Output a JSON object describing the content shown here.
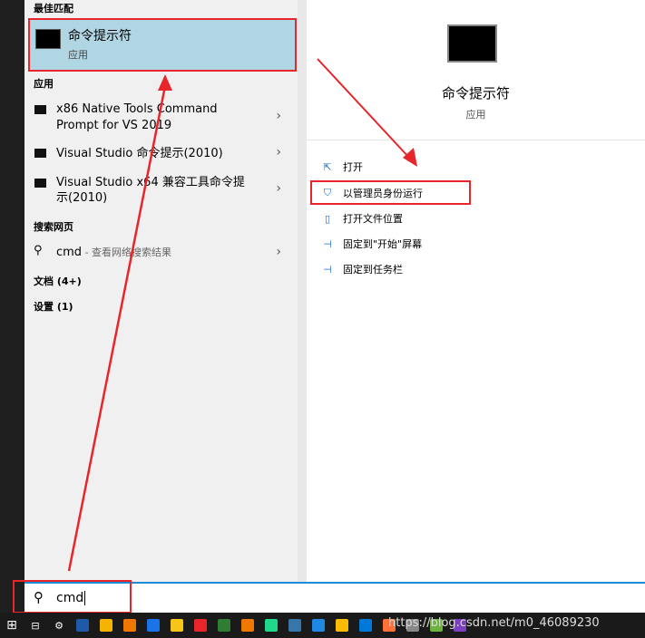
{
  "left": {
    "best_match_header": "最佳匹配",
    "best_match": {
      "title": "命令提示符",
      "subtitle": "应用"
    },
    "apps_header": "应用",
    "apps": [
      {
        "line1": "x86 Native Tools Command",
        "line2": "Prompt for VS 2019"
      },
      {
        "line1": "Visual Studio 命令提示(2010)"
      },
      {
        "line1": "Visual Studio x64 兼容工具命令提",
        "line2": "示(2010)"
      }
    ],
    "web_header": "搜索网页",
    "web_item": {
      "query": "cmd",
      "suffix": " - 查看网络搜索结果"
    },
    "docs": "文档 (4+)",
    "settings": "设置 (1)"
  },
  "right": {
    "title": "命令提示符",
    "subtitle": "应用",
    "actions": [
      {
        "icon": "open-icon",
        "label": "打开"
      },
      {
        "icon": "shield-icon",
        "label": "以管理员身份运行"
      },
      {
        "icon": "folder-icon",
        "label": "打开文件位置"
      },
      {
        "icon": "pin-icon",
        "label": "固定到\"开始\"屏幕"
      },
      {
        "icon": "pin-icon",
        "label": "固定到任务栏"
      }
    ]
  },
  "search": {
    "value": "cmd"
  },
  "watermark": "https://blog.csdn.net/m0_46089230",
  "taskbar_colors": [
    "#1e5aa8",
    "#f4b400",
    "#f07800",
    "#1a73e8",
    "#f5c518",
    "#e8252b",
    "#2e7d32",
    "#f07800",
    "#21d789",
    "#3776ab",
    "#1e88e5",
    "#fbbc05",
    "#0078d7",
    "#ff7139",
    "#888888",
    "#6db33f",
    "#7b3fbf"
  ],
  "highlight_color": "#e8252b"
}
